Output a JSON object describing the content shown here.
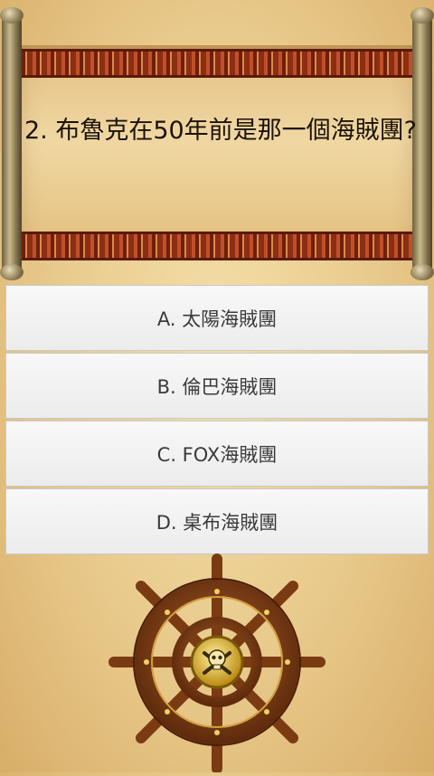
{
  "question": {
    "text": "2. 布魯克在50年前是那一個海賊團?"
  },
  "answers": [
    {
      "label": "A. 太陽海賊團"
    },
    {
      "label": "B. 倫巴海賊團"
    },
    {
      "label": "C. FOX海賊團"
    },
    {
      "label": "D. 桌布海賊團"
    }
  ],
  "decoration": {
    "wheel_icon": "ship-wheel-icon",
    "emblem_icon": "skull-crossbones-icon",
    "colors": {
      "parchment": "#f0d7a2",
      "border": "#8b2e14",
      "button_bg": "#f3f3f3",
      "button_text": "#3a3a3a"
    }
  }
}
